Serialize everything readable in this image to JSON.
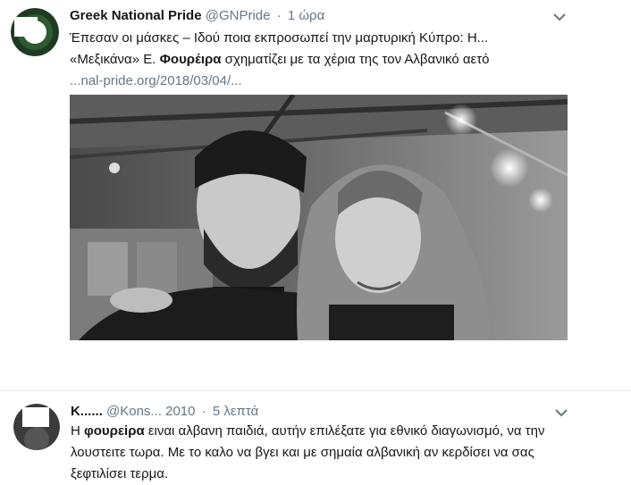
{
  "tweet1": {
    "name": "Greek National Pride",
    "handle": "@GNPride",
    "time": "1 ώρα",
    "text_line1": "Έπεσαν οι μάσκες – Ιδού ποια εκπροσωπεί την μαρτυρική Κύπρο: Η...",
    "text_line2_prefix": "«Μεξικάνα» Ε. ",
    "text_line2_bold": "Φουρέιρα",
    "text_line2_suffix": " σχηματίζει με τα χέρια της τον Αλβανικό αετό",
    "link": "...nal-pride.org/2018/03/04/...",
    "menu_icon": "chevron-down-icon"
  },
  "tweet2": {
    "name": "Κ......",
    "handle": "@Kons...",
    "year": "2010",
    "time": "5 λεπτά",
    "text_prefix": "Η ",
    "text_bold": "φουρεiρα",
    "text_rest": " ειναι αλβανη παιδιά, αυτήν επιλέξατε για εθνικό διαγωνισμό, να την λουστειτε τωρα. Με το καλο να βγει και με σημαία αλβανική αν κερδίσει να σας ξεφτιλίσει τερμα.",
    "menu_icon": "chevron-down-icon"
  },
  "colors": {
    "text": "#14171a",
    "secondary": "#657786",
    "divider": "#e6ecf0"
  }
}
